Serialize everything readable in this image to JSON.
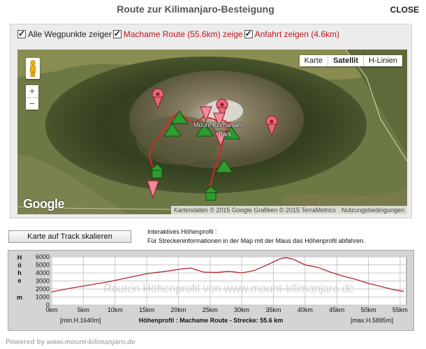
{
  "dialog": {
    "title": "Route zur Kilimanjaro-Besteigung",
    "close_label": "CLOSE"
  },
  "options": {
    "waypoints_label": "Alle Wegpunkte zeiger",
    "route_label": "Machame Route (55.6km) zeige",
    "approach_label": "Anfahrt zeigen (4.6km)"
  },
  "map": {
    "type_buttons": [
      "Karte",
      "Satellit",
      "H-Linien"
    ],
    "active_type": "Satellit",
    "zoom_in": "+",
    "zoom_out": "−",
    "peak_label_1": "Mount Kilimanjaro",
    "peak_label_2": "Park",
    "logo": "Google",
    "attribution": "Kartendaten © 2015 Google Grafiken © 2015 TerraMetrics",
    "terms": "Nutzungsbedingungen",
    "route_color": "#d62828"
  },
  "scale_button": "Karte auf Track skalieren",
  "profile_info": {
    "title": "Interaktives Höhenprofil :",
    "text": "Für Streckeninformationen in der Map mit der Maus das Höhenprofil abfahren."
  },
  "chart_data": {
    "type": "line",
    "ylabel": "Höhe m",
    "ylim": [
      0,
      6000
    ],
    "xlim": [
      0,
      56
    ],
    "y_ticks": [
      "6000",
      "5000",
      "4000",
      "3000",
      "2000",
      "1000",
      "0"
    ],
    "x_ticks": [
      "0km",
      "5km",
      "10km",
      "15km",
      "20km",
      "25km",
      "30km",
      "35km",
      "40km",
      "45km",
      "50km",
      "55km"
    ],
    "watermark": "Routen Höhenprofil von www.mount-kilimanjaro.de",
    "min_label": "[min.H.1640m]",
    "max_label": "[max.H.5895m]",
    "caption": "Höhenprofil : Machame Route  -  Strecke: 55.6 km",
    "line_color": "#b3262d",
    "series": [
      {
        "x": [
          0,
          3,
          6,
          9,
          12,
          15,
          18,
          21,
          22,
          24,
          26,
          28,
          30,
          32,
          34,
          36,
          37,
          38,
          40,
          42,
          44,
          46,
          48,
          50,
          52,
          54,
          55.6
        ],
        "y": [
          1640,
          2100,
          2500,
          2900,
          3400,
          3900,
          4200,
          4550,
          4600,
          4100,
          4050,
          4200,
          4000,
          4300,
          5000,
          5750,
          5895,
          5750,
          5000,
          4700,
          4100,
          3600,
          3200,
          2700,
          2300,
          1900,
          1700
        ]
      }
    ]
  },
  "footer": {
    "prefix": "Powered by",
    "site": "www.mount-kilimanjaro.de"
  }
}
